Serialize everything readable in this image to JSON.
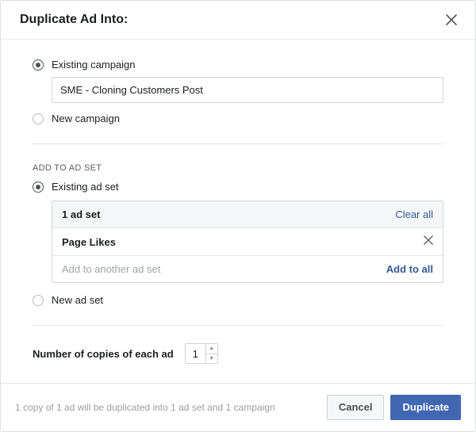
{
  "dialog": {
    "title": "Duplicate Ad Into:"
  },
  "campaign": {
    "existing_label": "Existing campaign",
    "existing_value": "SME - Cloning Customers Post",
    "new_label": "New campaign"
  },
  "adset": {
    "section_label": "ADD TO AD SET",
    "existing_label": "Existing ad set",
    "count_label": "1 ad set",
    "clear_all": "Clear all",
    "rows": [
      {
        "name": "Page Likes"
      }
    ],
    "add_placeholder": "Add to another ad set",
    "add_to_all": "Add to all",
    "new_label": "New ad set"
  },
  "copies": {
    "label": "Number of copies of each ad",
    "value": "1"
  },
  "footer": {
    "note": "1 copy of 1 ad will be duplicated into 1 ad set and 1 campaign",
    "cancel": "Cancel",
    "duplicate": "Duplicate"
  }
}
